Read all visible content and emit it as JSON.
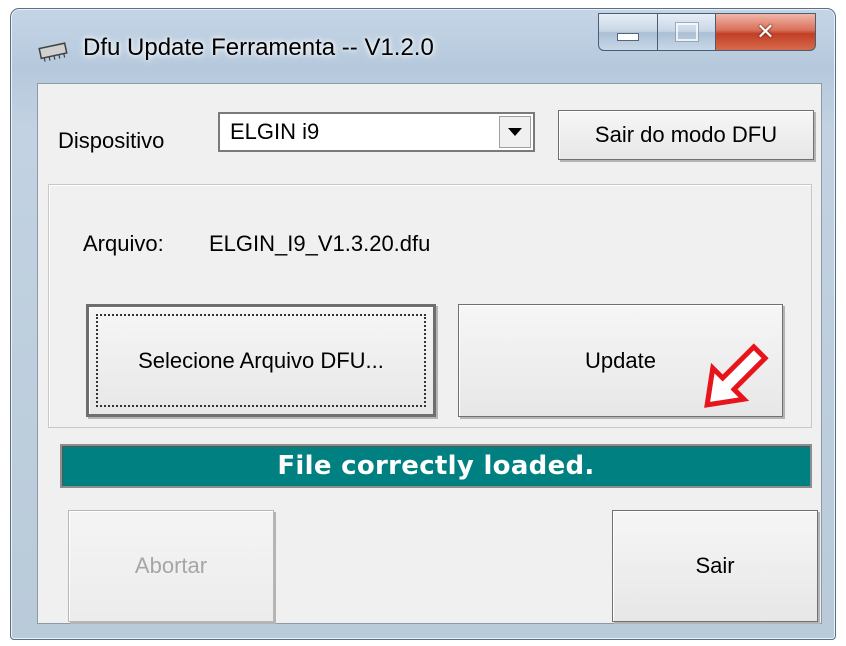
{
  "window": {
    "title": "Dfu Update Ferramenta -- V1.2.0",
    "close_glyph": "✕"
  },
  "device": {
    "label": "Dispositivo",
    "selected": "ELGIN i9",
    "exit_dfu_label": "Sair do modo DFU"
  },
  "file": {
    "label": "Arquivo:",
    "name": "ELGIN_I9_V1.3.20.dfu",
    "select_label": "Selecione Arquivo DFU...",
    "update_label": "Update"
  },
  "status": {
    "text": "File correctly loaded.",
    "color": "#008080"
  },
  "footer": {
    "abort_label": "Abortar",
    "exit_label": "Sair"
  },
  "annotation": {
    "arrow_color": "#e8141b",
    "icon": "red-arrow-icon"
  },
  "icons": {
    "app": "chip-icon",
    "minimize": "minimize-icon",
    "maximize": "maximize-icon",
    "close": "close-icon",
    "dropdown": "chevron-down-icon"
  }
}
